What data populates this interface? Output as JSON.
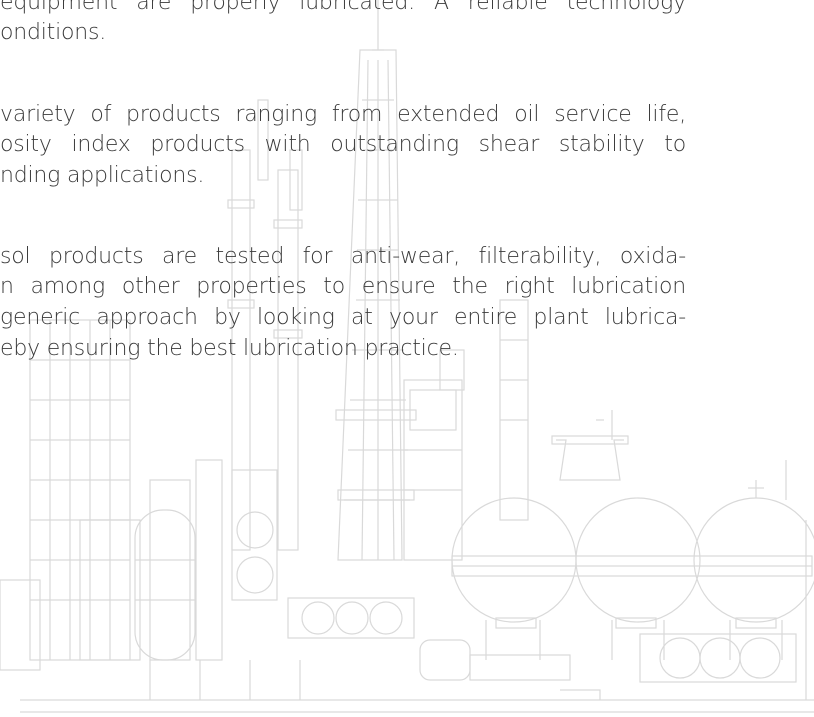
{
  "body_text": {
    "paragraph_1": [
      "equipment are properly lubricated. A reliable technology",
      "onditions."
    ],
    "paragraph_2": [
      "variety of products ranging from extended oil service life,",
      "osity index products with outstanding shear stability to",
      "nding applications."
    ],
    "paragraph_3": [
      "sol products are tested for anti-wear, filterability, oxida-",
      "n among other properties to ensure the right lubrication",
      "generic approach by looking at your entire plant lubrica-",
      "eby ensuring the best lubrication practice."
    ]
  },
  "illustration": {
    "subject": "industrial refinery line drawing",
    "stroke_color": "#d9d9d9"
  },
  "colors": {
    "text": "#3a3a3a",
    "background": "#ffffff",
    "illustration_stroke": "#d9d9d9"
  }
}
